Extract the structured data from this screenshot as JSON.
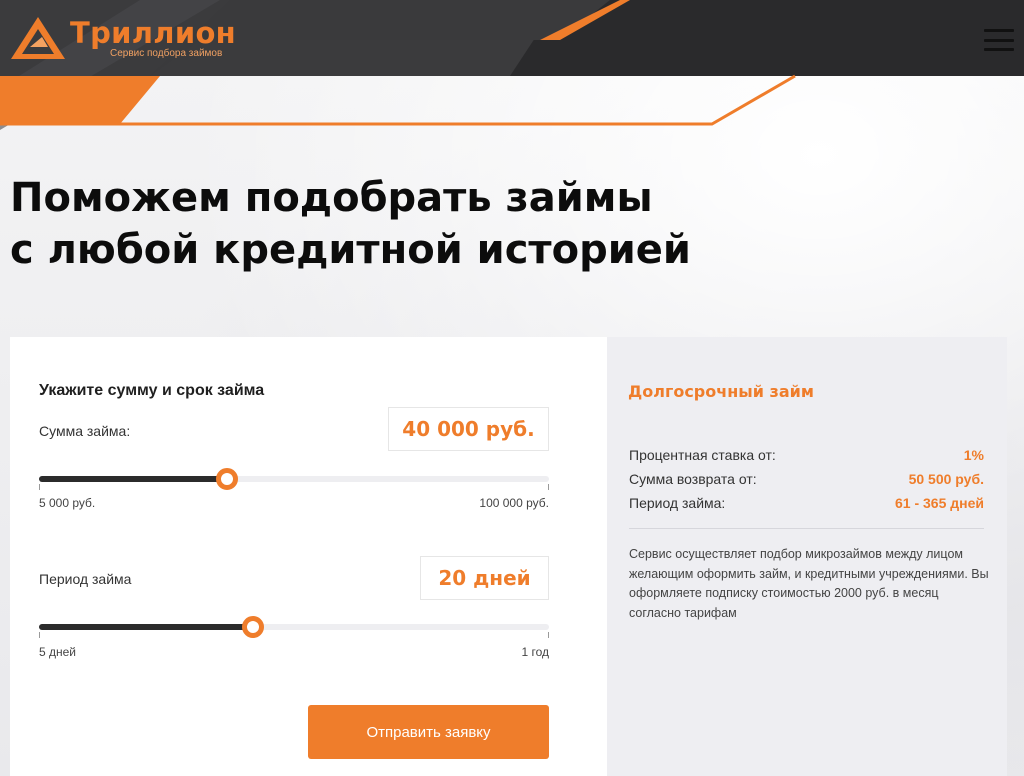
{
  "header": {
    "brand_name": "Триллион",
    "brand_tagline": "Сервис подбора займов",
    "menu_icon": "hamburger-menu-icon",
    "colors": {
      "accent": "#ef7d2b",
      "dark": "#3a3a3a"
    }
  },
  "hero": {
    "title_line1": "Поможем подобрать займы",
    "title_line2": "с любой кредитной историей"
  },
  "calculator": {
    "heading": "Укажите сумму и срок займа",
    "amount": {
      "label": "Сумма займа:",
      "value": "40 000 руб.",
      "min_label": "5 000 руб.",
      "max_label": "100 000 руб.",
      "min": 5000,
      "max": 100000,
      "current": 40000
    },
    "period": {
      "label": "Период займа",
      "value": "20 дней",
      "min_label": "5 дней",
      "max_label": "1 год",
      "fill_fraction": 0.42
    },
    "submit_label": "Отправить заявку"
  },
  "offer": {
    "heading": "Долгосрочный займ",
    "rows": [
      {
        "label": "Процентная ставка от:",
        "value": "1%"
      },
      {
        "label": "Сумма возврата от:",
        "value": "50 500 руб."
      },
      {
        "label": "Период займа:",
        "value": "61 - 365 дней"
      }
    ],
    "note": "Сервис осуществляет подбор микрозаймов между лицом желающим оформить займ, и кредитными учреждениями. Вы оформляете подписку стоимостью 2000 руб. в месяц согласно тарифам"
  }
}
